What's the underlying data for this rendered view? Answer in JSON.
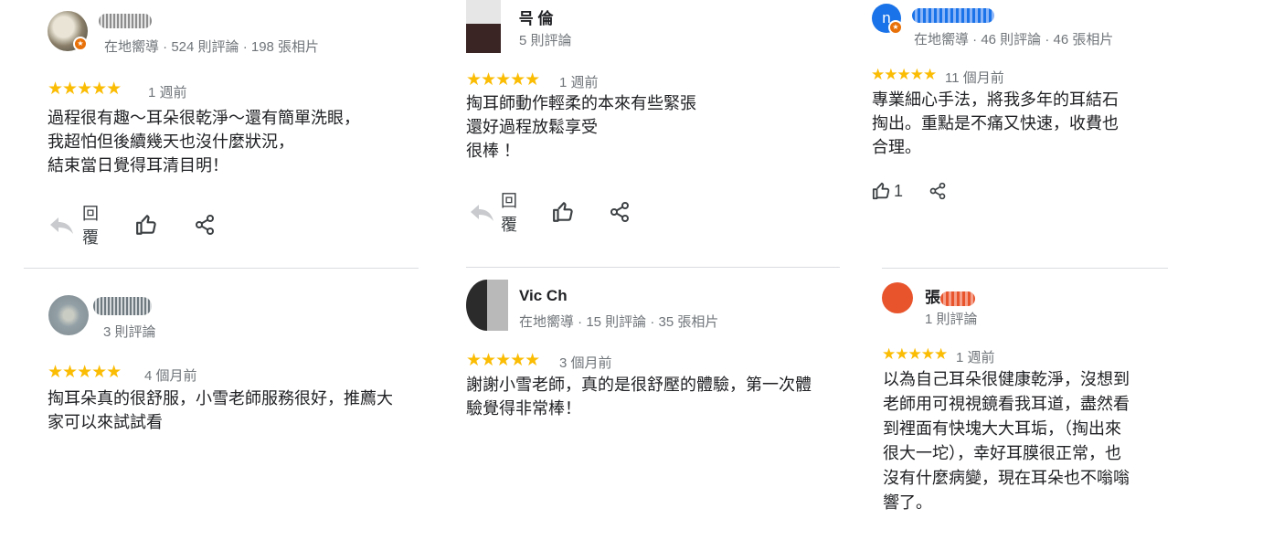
{
  "reviews": [
    {
      "name": "",
      "meta": "在地嚮導 · 524 則評論 · 198 張相片",
      "stars": "★★★★★",
      "when": "1 週前",
      "lines": [
        "過程很有趣～耳朵很乾淨～還有簡單洗眼，",
        "我超怕但後續幾天也沒什麼狀況，",
        "結束當日覺得耳清目明！"
      ],
      "reply_label": "回覆"
    },
    {
      "name": "믁  倫",
      "meta": "5 則評論",
      "stars": "★★★★★",
      "when": "1 週前",
      "lines": [
        "掏耳師動作輕柔的本來有些緊張",
        "還好過程放鬆享受",
        "很棒 ！"
      ],
      "reply_label": "回覆"
    },
    {
      "avatar_letter": "n",
      "name": "",
      "meta": "在地嚮導 · 46 則評論 · 46 張相片",
      "stars": "★★★★★",
      "when": "11 個月前",
      "lines": [
        "專業細心手法，將我多年的耳結石",
        "掏出。重點是不痛又快速，收費也",
        "合理。"
      ],
      "like_count": "1"
    },
    {
      "name": "",
      "meta": "3 則評論",
      "stars": "★★★★★",
      "when": "4 個月前",
      "lines": [
        "掏耳朵真的很舒服，小雪老師服務很好，推薦大",
        "家可以來試試看"
      ]
    },
    {
      "name": "Vic        Ch",
      "meta": "在地嚮導 · 15 則評論 · 35 張相片",
      "stars": "★★★★★",
      "when": "3 個月前",
      "lines": [
        "謝謝小雪老師，真的是很舒壓的體驗，第一次體",
        "驗覺得非常棒！"
      ]
    },
    {
      "name": "張",
      "meta": "1 則評論",
      "stars": "★★★★★",
      "when": "1 週前",
      "lines": [
        "以為自己耳朵很健康乾淨，沒想到",
        "老師用可視視鏡看我耳道，盡然看",
        "到裡面有快塊大大耳垢，（掏出來",
        "很大一坨），幸好耳膜很正常，也",
        "沒有什麼病變，現在耳朵也不嗡嗡",
        "響了。"
      ]
    }
  ],
  "colors": {
    "star": "#fbbc04",
    "meta": "#70757a",
    "divider": "#dadce0",
    "badge": "#e8710a",
    "avatar_n": "#1a73e8",
    "avatar_zhang": "#e8552d"
  },
  "icons": [
    "reply-icon",
    "thumbs-up-icon",
    "share-icon"
  ]
}
